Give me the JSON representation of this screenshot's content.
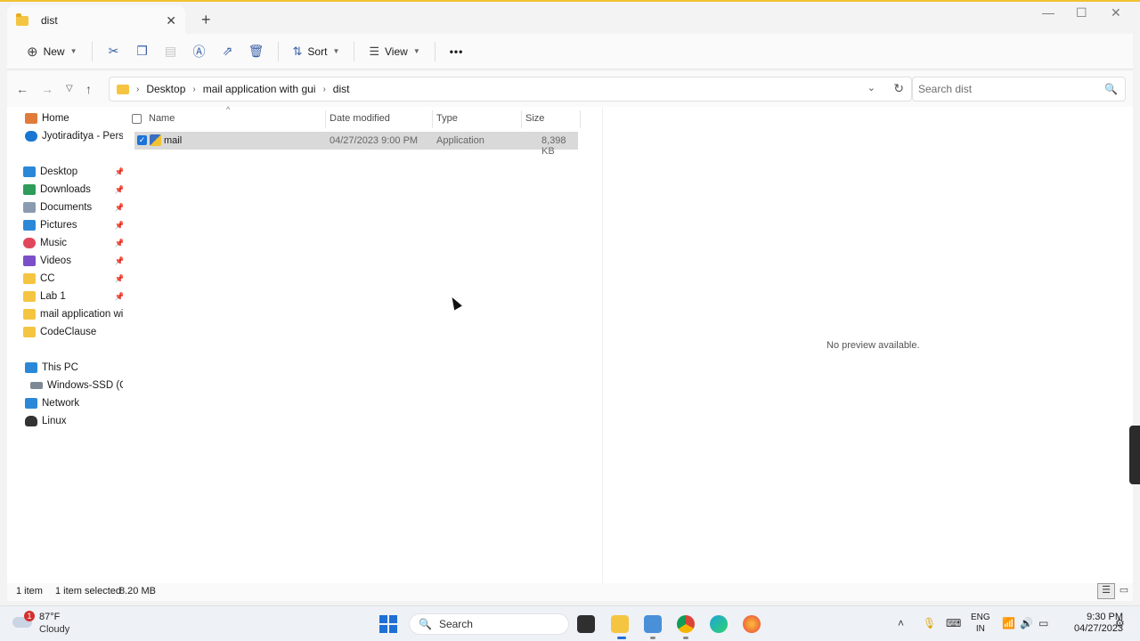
{
  "tab": {
    "title": "dist",
    "close_glyph": "✕",
    "add_glyph": "+"
  },
  "window": {
    "minimize": "—",
    "maximize": "☐",
    "close": "✕"
  },
  "toolbar": {
    "new_label": "New",
    "sort_label": "Sort",
    "view_label": "View",
    "more_glyph": "•••",
    "icons": [
      "cut-icon",
      "copy-icon",
      "paste-icon",
      "rename-icon",
      "share-icon",
      "delete-icon"
    ]
  },
  "address": {
    "crumbs": [
      "Desktop",
      "mail application with gui",
      "dist"
    ],
    "search_placeholder": "Search dist"
  },
  "sidebar": {
    "items": [
      {
        "label": "Home",
        "color": "#e07b39"
      },
      {
        "label": "Jyotiraditya - Persona",
        "color": "#1976d2"
      },
      {
        "label": "Desktop",
        "color": "#2b88d8",
        "pinned": true
      },
      {
        "label": "Downloads",
        "color": "#2e9c5b",
        "pinned": true
      },
      {
        "label": "Documents",
        "color": "#8a9bb0",
        "pinned": true
      },
      {
        "label": "Pictures",
        "color": "#2b88d8",
        "pinned": true
      },
      {
        "label": "Music",
        "color": "#e0475d",
        "pinned": true
      },
      {
        "label": "Videos",
        "color": "#7b4fc9",
        "pinned": true
      },
      {
        "label": "CC",
        "color": "#f5c542",
        "pinned": true
      },
      {
        "label": "Lab 1",
        "color": "#f5c542",
        "pinned": true
      },
      {
        "label": "mail application with",
        "color": "#f5c542"
      },
      {
        "label": "CodeClause",
        "color": "#f5c542"
      },
      {
        "label": "This PC",
        "color": "#2b88d8"
      },
      {
        "label": "Windows-SSD (C:)",
        "color": "#7d8894"
      },
      {
        "label": "Network",
        "color": "#2b88d8"
      },
      {
        "label": "Linux",
        "color": "#333333"
      }
    ]
  },
  "columns": {
    "name": "Name",
    "date": "Date modified",
    "type": "Type",
    "size": "Size"
  },
  "files": [
    {
      "name": "mail",
      "date": "04/27/2023 9:00 PM",
      "type": "Application",
      "size": "8,398 KB",
      "selected": true
    }
  ],
  "preview": {
    "text": "No preview available."
  },
  "status": {
    "count": "1 item",
    "selection": "1 item selected",
    "size": "8.20 MB"
  },
  "taskbar": {
    "weather_badge": "1",
    "temperature": "87°F",
    "condition": "Cloudy",
    "search_label": "Search",
    "lang_line1": "ENG",
    "lang_line2": "IN",
    "time": "9:30 PM",
    "date": "04/27/2023"
  }
}
